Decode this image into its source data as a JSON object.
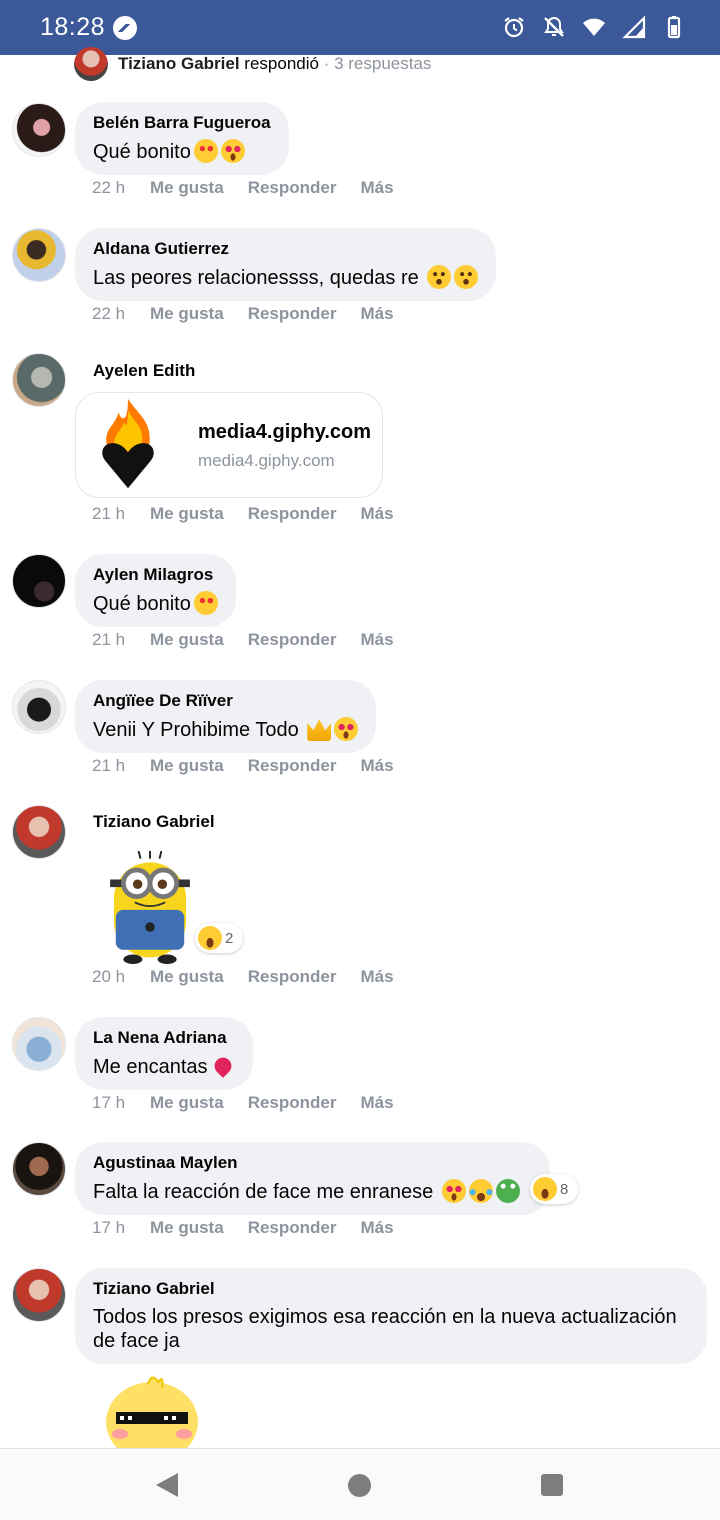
{
  "status_bar": {
    "time": "18:28",
    "icons": [
      "messenger-icon",
      "alarm-icon",
      "bell-off-icon",
      "wifi-icon",
      "signal-icon",
      "battery-icon"
    ]
  },
  "thread_header": {
    "author": "Tiziano Gabriel",
    "action": "respondió",
    "replies": "· 3 respuestas"
  },
  "actions": {
    "like": "Me gusta",
    "reply": "Responder",
    "more": "Más"
  },
  "comments": [
    {
      "author": "Belén Barra Fugueroa",
      "text": "Qué bonito",
      "emojis": [
        "smiling-face-with-hearts",
        "heart-eyes"
      ],
      "time": "22 h"
    },
    {
      "author": "Aldana Gutierrez",
      "text": "Las peores relacionessss, quedas re",
      "emojis": [
        "wow-face",
        "wow-face"
      ],
      "time": "22 h"
    },
    {
      "author": "Ayelen Edith",
      "link_title": "media4.giphy.com",
      "link_domain": "media4.giphy.com",
      "time": "21 h"
    },
    {
      "author": "Aylen Milagros",
      "text": "Qué bonito",
      "emojis": [
        "smiling-face-with-hearts"
      ],
      "time": "21 h"
    },
    {
      "author": "Angïïee De Rïïver",
      "text": "Venii Y Prohibime Todo",
      "emojis": [
        "crown",
        "heart-eyes"
      ],
      "time": "21 h"
    },
    {
      "author": "Tiziano Gabriel",
      "sticker": "minion-sticker",
      "reaction_count": "2",
      "time": "20 h"
    },
    {
      "author": "La Nena Adriana",
      "text": "Me encantas",
      "emojis": [
        "two-hearts"
      ],
      "time": "17 h"
    },
    {
      "author": "Agustinaa Maylen",
      "text": "Falta la reacción de face me enranese",
      "emojis": [
        "heart-eyes",
        "tears-of-joy",
        "frog"
      ],
      "reaction_count": "8",
      "time": "17 h"
    },
    {
      "author": "Tiziano Gabriel",
      "text": "Todos los presos exigimos esa reacción en la nueva actualización de face ja",
      "sticker": "chick-sunglasses-sticker"
    }
  ],
  "nav": [
    "back-icon",
    "home-icon",
    "recents-icon"
  ],
  "colors": {
    "status_bar": "#3b5998",
    "bubble": "#eff1f4",
    "meta_text": "#8d949e"
  }
}
